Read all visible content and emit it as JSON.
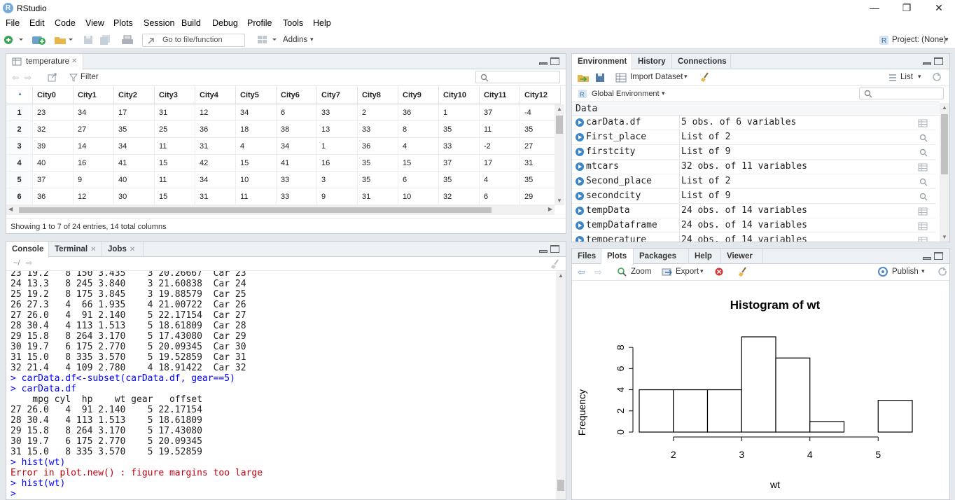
{
  "window": {
    "title": "RStudio",
    "minimize": "—",
    "restore": "❐",
    "close": "✕"
  },
  "menu": [
    "File",
    "Edit",
    "Code",
    "View",
    "Plots",
    "Session",
    "Build",
    "Debug",
    "Profile",
    "Tools",
    "Help"
  ],
  "toolbar": {
    "goto_placeholder": "Go to file/function",
    "addins": "Addins",
    "project": "Project: (None)"
  },
  "source": {
    "tab": "temperature",
    "filter": "Filter",
    "columns": [
      "City0",
      "City1",
      "City2",
      "City3",
      "City4",
      "City5",
      "City6",
      "City7",
      "City8",
      "City9",
      "City10",
      "City11",
      "City12"
    ],
    "rows": [
      {
        "n": "1",
        "v": [
          "23",
          "34",
          "17",
          "31",
          "12",
          "34",
          "6",
          "33",
          "2",
          "36",
          "1",
          "37",
          "-4"
        ]
      },
      {
        "n": "2",
        "v": [
          "32",
          "27",
          "35",
          "25",
          "36",
          "18",
          "38",
          "13",
          "33",
          "8",
          "35",
          "11",
          "35"
        ]
      },
      {
        "n": "3",
        "v": [
          "39",
          "14",
          "34",
          "11",
          "31",
          "4",
          "34",
          "1",
          "36",
          "4",
          "33",
          "-2",
          "27"
        ]
      },
      {
        "n": "4",
        "v": [
          "40",
          "16",
          "41",
          "15",
          "42",
          "15",
          "41",
          "16",
          "35",
          "15",
          "37",
          "17",
          "31"
        ]
      },
      {
        "n": "5",
        "v": [
          "37",
          "9",
          "40",
          "11",
          "34",
          "10",
          "33",
          "3",
          "35",
          "6",
          "35",
          "4",
          "35"
        ]
      },
      {
        "n": "6",
        "v": [
          "36",
          "12",
          "30",
          "15",
          "31",
          "11",
          "33",
          "9",
          "31",
          "10",
          "32",
          "6",
          "29"
        ]
      }
    ],
    "status": "Showing 1 to 7 of 24 entries, 14 total columns"
  },
  "env": {
    "tabs": [
      "Environment",
      "History",
      "Connections"
    ],
    "import": "Import Dataset",
    "list": "List",
    "scope": "Global Environment",
    "section": "Data",
    "items": [
      {
        "name": "carData.df",
        "value": "5 obs. of 6 variables",
        "icon": "table-icon"
      },
      {
        "name": "First_place",
        "value": "List of 2",
        "icon": "search-icon"
      },
      {
        "name": "firstcity",
        "value": "List of 9",
        "icon": "search-icon"
      },
      {
        "name": "mtcars",
        "value": "32 obs. of 11 variables",
        "icon": "table-icon"
      },
      {
        "name": "Second_place",
        "value": "List of 2",
        "icon": "search-icon"
      },
      {
        "name": "secondcity",
        "value": "List of 9",
        "icon": "search-icon"
      },
      {
        "name": "tempData",
        "value": "24 obs. of 14 variables",
        "icon": "table-icon"
      },
      {
        "name": "tempDataframe",
        "value": "24 obs. of 14 variables",
        "icon": "table-icon"
      },
      {
        "name": "temperature",
        "value": "24 obs. of 14 variables",
        "icon": "table-icon"
      }
    ]
  },
  "console": {
    "tabs": [
      "Console",
      "Terminal",
      "Jobs"
    ],
    "path": "~/",
    "lines": [
      {
        "t": "23 19.2   8 150 3.435    3 20.26667  Car 23",
        "c": "out"
      },
      {
        "t": "24 13.3   8 245 3.840    3 21.60838  Car 24",
        "c": "out"
      },
      {
        "t": "25 19.2   8 175 3.845    3 19.88579  Car 25",
        "c": "out"
      },
      {
        "t": "26 27.3   4  66 1.935    4 21.00722  Car 26",
        "c": "out"
      },
      {
        "t": "27 26.0   4  91 2.140    5 22.17154  Car 27",
        "c": "out"
      },
      {
        "t": "28 30.4   4 113 1.513    5 18.61809  Car 28",
        "c": "out"
      },
      {
        "t": "29 15.8   8 264 3.170    5 17.43080  Car 29",
        "c": "out"
      },
      {
        "t": "30 19.7   6 175 2.770    5 20.09345  Car 30",
        "c": "out"
      },
      {
        "t": "31 15.0   8 335 3.570    5 19.52859  Car 31",
        "c": "out"
      },
      {
        "t": "32 21.4   4 109 2.780    4 18.91422  Car 32",
        "c": "out"
      },
      {
        "t": "> carData.df<-subset(carData.df, gear==5)",
        "c": "in"
      },
      {
        "t": "> carData.df",
        "c": "in"
      },
      {
        "t": "    mpg cyl  hp    wt gear   offset",
        "c": "out"
      },
      {
        "t": "27 26.0   4  91 2.140    5 22.17154",
        "c": "out"
      },
      {
        "t": "28 30.4   4 113 1.513    5 18.61809",
        "c": "out"
      },
      {
        "t": "29 15.8   8 264 3.170    5 17.43080",
        "c": "out"
      },
      {
        "t": "30 19.7   6 175 2.770    5 20.09345",
        "c": "out"
      },
      {
        "t": "31 15.0   8 335 3.570    5 19.52859",
        "c": "out"
      },
      {
        "t": "> hist(wt)",
        "c": "in"
      },
      {
        "t": "Error in plot.new() : figure margins too large",
        "c": "err"
      },
      {
        "t": "> hist(wt)",
        "c": "in"
      },
      {
        "t": "> ",
        "c": "in"
      }
    ]
  },
  "files": {
    "tabs": [
      "Files",
      "Plots",
      "Packages",
      "Help",
      "Viewer"
    ],
    "zoom": "Zoom",
    "export": "Export",
    "publish": "Publish"
  },
  "chart_data": {
    "type": "bar",
    "title": "Histogram of wt",
    "xlabel": "wt",
    "ylabel": "Frequency",
    "bins": [
      [
        1.5,
        2.0
      ],
      [
        2.0,
        2.5
      ],
      [
        2.5,
        3.0
      ],
      [
        3.0,
        3.5
      ],
      [
        3.5,
        4.0
      ],
      [
        4.0,
        4.5
      ],
      [
        4.5,
        5.0
      ],
      [
        5.0,
        5.5
      ]
    ],
    "values": [
      4,
      4,
      4,
      9,
      7,
      1,
      0,
      3
    ],
    "xticks": [
      2,
      3,
      4,
      5
    ],
    "yticks": [
      0,
      2,
      4,
      6,
      8
    ],
    "xlim": [
      1.5,
      5.5
    ],
    "ylim": [
      0,
      9
    ]
  }
}
